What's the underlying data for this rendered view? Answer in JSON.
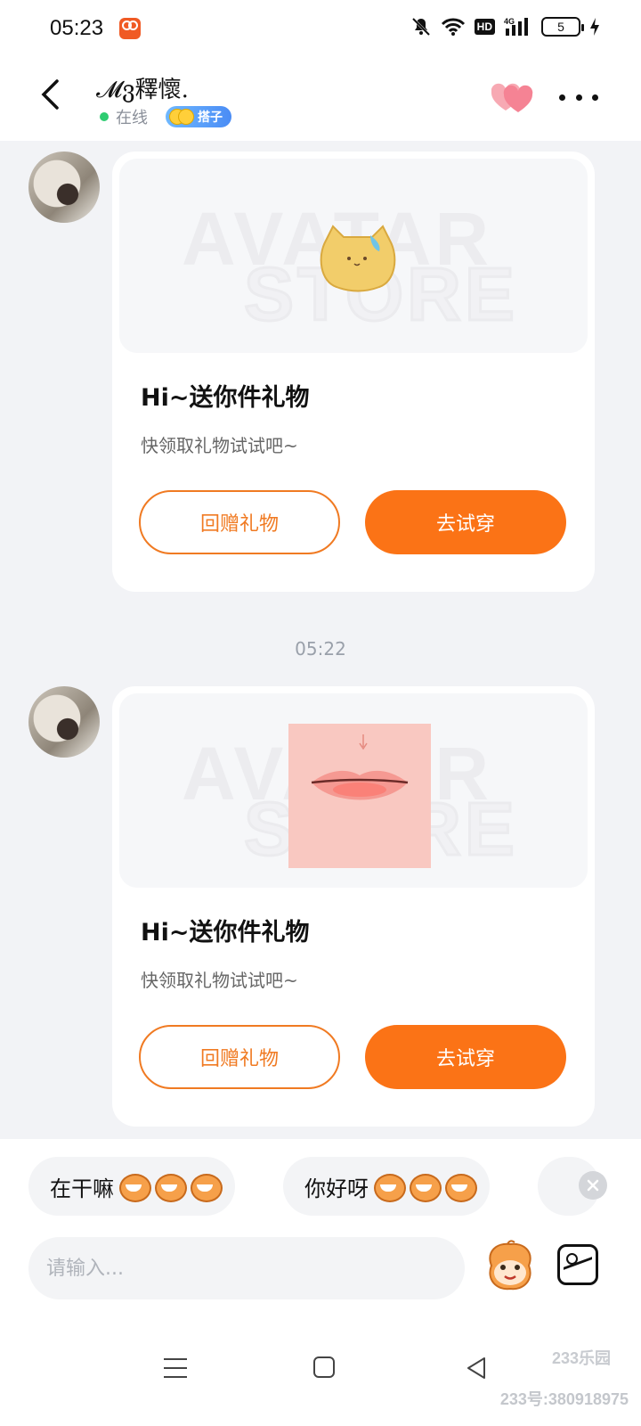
{
  "status_bar": {
    "time": "05:23",
    "hd_label": "HD",
    "network_label": "4G",
    "battery_level": "5",
    "icons": [
      "app-icon",
      "mute-bell-icon",
      "wifi-icon",
      "signal-icon",
      "battery-icon",
      "charging-icon"
    ]
  },
  "header": {
    "title": "𝓜ვ釋懷.",
    "status_text": "在线",
    "badge_label": "搭子",
    "colors": {
      "online": "#2ecc71",
      "accent": "#fb7316"
    }
  },
  "messages": [
    {
      "type": "gift",
      "watermark_line1": "AVATAR",
      "watermark_line2": "STORE",
      "item_icon": "yellow-cat-item",
      "title": "Hi~送你件礼物",
      "subtitle": "快领取礼物试试吧~",
      "return_label": "回赠礼物",
      "try_label": "去试穿"
    },
    {
      "type": "gift",
      "watermark_line1": "AVATAR",
      "watermark_line2": "STORE",
      "item_icon": "lips-makeup-item",
      "title": "Hi~送你件礼物",
      "subtitle": "快领取礼物试试吧~",
      "return_label": "回赠礼物",
      "try_label": "去试穿"
    }
  ],
  "timestamp": "05:22",
  "quick_replies": [
    "在干嘛",
    "你好呀"
  ],
  "input": {
    "placeholder": "请输入..."
  },
  "watermark": {
    "badge": "233乐园",
    "id": "233号:380918975"
  }
}
